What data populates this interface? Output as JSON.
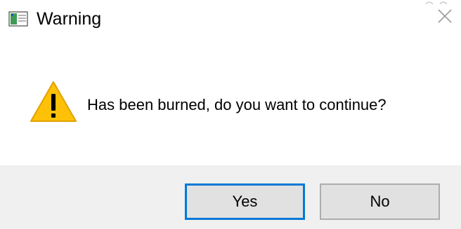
{
  "window": {
    "title": "Warning",
    "icon": "app-window-icon",
    "close_icon": "close-icon"
  },
  "content": {
    "icon": "warning-icon",
    "message": "Has been burned, do you want to continue?"
  },
  "buttons": {
    "yes_label": "Yes",
    "no_label": "No",
    "default": "Yes"
  },
  "colors": {
    "focus_border": "#0078d7",
    "footer_bg": "#f0f0f0",
    "warning_fill": "#ffc107"
  }
}
